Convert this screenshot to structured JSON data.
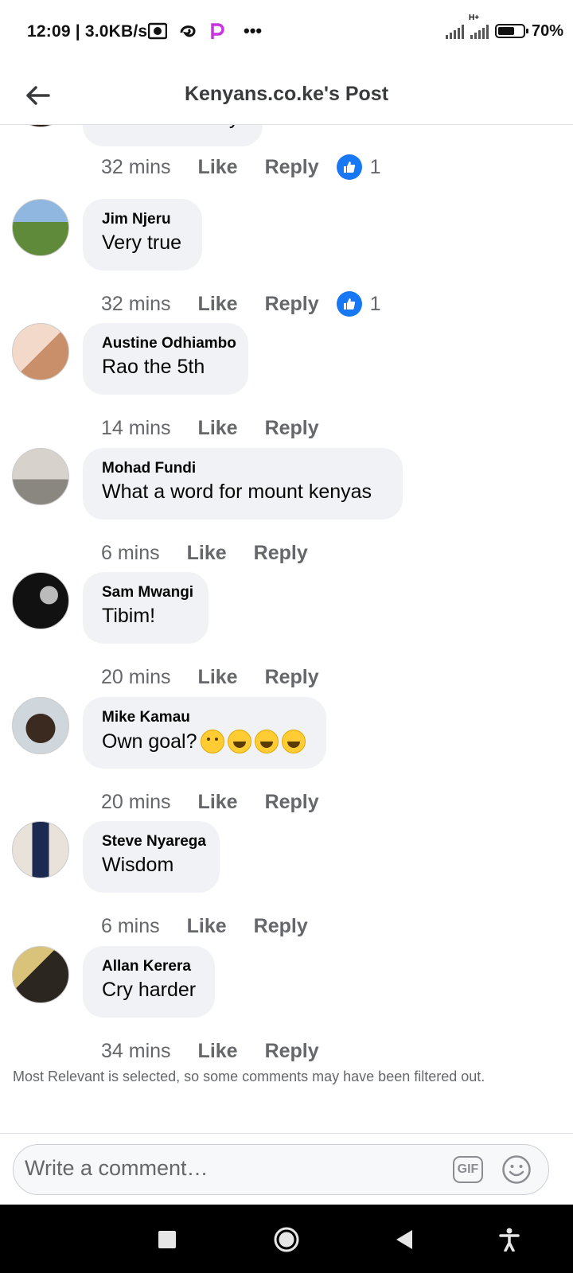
{
  "status_bar": {
    "time": "12:09",
    "speed": "| 3.0KB/s",
    "network_label": "H+",
    "battery_level": 0.7,
    "battery": "70%"
  },
  "header": {
    "title": "Kenyans.co.ke's Post",
    "back_icon": "arrow-left-icon"
  },
  "comments": [
    {
      "name": "",
      "text": "Baba is already",
      "time": "32 mins",
      "like": "Like",
      "reply": "Reply",
      "reactions": "1"
    },
    {
      "name": "Jim Njeru",
      "text": "Very true",
      "time": "32 mins",
      "like": "Like",
      "reply": "Reply",
      "reactions": "1"
    },
    {
      "name": "Austine Odhiambo",
      "text": "Rao the 5th",
      "time": "14 mins",
      "like": "Like",
      "reply": "Reply"
    },
    {
      "name": "Mohad Fundi",
      "text": "What a word for mount kenyas",
      "time": "6 mins",
      "like": "Like",
      "reply": "Reply"
    },
    {
      "name": "Sam Mwangi",
      "text": "Tibim!",
      "time": "20 mins",
      "like": "Like",
      "reply": "Reply"
    },
    {
      "name": "Mike Kamau",
      "text": "Own goal?",
      "emojis": [
        "thinking-face-emoji",
        "grinning-sweat-emoji",
        "tears-of-joy-emoji",
        "tears-of-joy-emoji"
      ],
      "time": "20 mins",
      "like": "Like",
      "reply": "Reply"
    },
    {
      "name": "Steve Nyarega",
      "text": "Wisdom",
      "time": "6 mins",
      "like": "Like",
      "reply": "Reply"
    },
    {
      "name": "Allan Kerera",
      "text": "Cry harder",
      "time": "34 mins",
      "like": "Like",
      "reply": "Reply"
    }
  ],
  "notice": "Most Relevant is selected, so some comments may have been filtered out.",
  "composer": {
    "placeholder": "Write a comment…",
    "gif_label": "GIF"
  },
  "colors": {
    "accent": "#1877f2",
    "bubble": "#f0f2f5",
    "meta_text": "#65676b",
    "navbar": "#000000"
  }
}
